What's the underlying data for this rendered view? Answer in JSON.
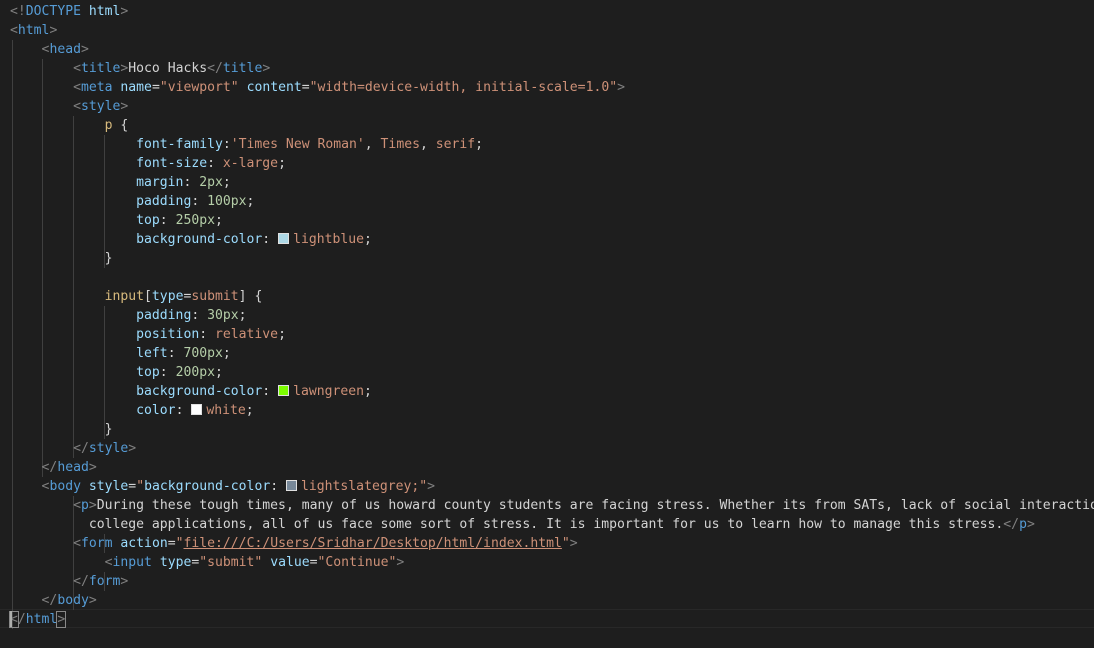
{
  "lines": [
    {
      "tokens": [
        {
          "t": "<!",
          "c": "punc"
        },
        {
          "t": "DOCTYPE",
          "c": "tag"
        },
        {
          "t": " html",
          "c": "attr"
        },
        {
          "t": ">",
          "c": "punc"
        }
      ]
    },
    {
      "tokens": [
        {
          "t": "<",
          "c": "punc"
        },
        {
          "t": "html",
          "c": "tag"
        },
        {
          "t": ">",
          "c": "punc"
        }
      ]
    },
    {
      "tokens": [
        {
          "t": "    "
        },
        {
          "t": "<",
          "c": "punc"
        },
        {
          "t": "head",
          "c": "tag"
        },
        {
          "t": ">",
          "c": "punc"
        }
      ]
    },
    {
      "tokens": [
        {
          "t": "        "
        },
        {
          "t": "<",
          "c": "punc"
        },
        {
          "t": "title",
          "c": "tag"
        },
        {
          "t": ">",
          "c": "punc"
        },
        {
          "t": "Hoco Hacks",
          "c": "text"
        },
        {
          "t": "</",
          "c": "punc"
        },
        {
          "t": "title",
          "c": "tag"
        },
        {
          "t": ">",
          "c": "punc"
        }
      ]
    },
    {
      "tokens": [
        {
          "t": "        "
        },
        {
          "t": "<",
          "c": "punc"
        },
        {
          "t": "meta",
          "c": "tag"
        },
        {
          "t": " "
        },
        {
          "t": "name",
          "c": "attr"
        },
        {
          "t": "=",
          "c": "text"
        },
        {
          "t": "\"viewport\"",
          "c": "str"
        },
        {
          "t": " "
        },
        {
          "t": "content",
          "c": "attr"
        },
        {
          "t": "=",
          "c": "text"
        },
        {
          "t": "\"width=device-width, initial-scale=1.0\"",
          "c": "str"
        },
        {
          "t": ">",
          "c": "punc"
        }
      ]
    },
    {
      "tokens": [
        {
          "t": "        "
        },
        {
          "t": "<",
          "c": "punc"
        },
        {
          "t": "style",
          "c": "tag"
        },
        {
          "t": ">",
          "c": "punc"
        }
      ]
    },
    {
      "tokens": [
        {
          "t": "            "
        },
        {
          "t": "p",
          "c": "sel"
        },
        {
          "t": " {",
          "c": "text"
        }
      ]
    },
    {
      "tokens": [
        {
          "t": "                "
        },
        {
          "t": "font-family",
          "c": "prop"
        },
        {
          "t": ":",
          "c": "text"
        },
        {
          "t": "'Times New Roman'",
          "c": "val"
        },
        {
          "t": ", ",
          "c": "text"
        },
        {
          "t": "Times",
          "c": "val"
        },
        {
          "t": ", ",
          "c": "text"
        },
        {
          "t": "serif",
          "c": "val"
        },
        {
          "t": ";",
          "c": "text"
        }
      ]
    },
    {
      "tokens": [
        {
          "t": "                "
        },
        {
          "t": "font-size",
          "c": "prop"
        },
        {
          "t": ": ",
          "c": "text"
        },
        {
          "t": "x-large",
          "c": "val"
        },
        {
          "t": ";",
          "c": "text"
        }
      ]
    },
    {
      "tokens": [
        {
          "t": "                "
        },
        {
          "t": "margin",
          "c": "prop"
        },
        {
          "t": ": ",
          "c": "text"
        },
        {
          "t": "2px",
          "c": "num"
        },
        {
          "t": ";",
          "c": "text"
        }
      ]
    },
    {
      "tokens": [
        {
          "t": "                "
        },
        {
          "t": "padding",
          "c": "prop"
        },
        {
          "t": ": ",
          "c": "text"
        },
        {
          "t": "100px",
          "c": "num"
        },
        {
          "t": ";",
          "c": "text"
        }
      ]
    },
    {
      "tokens": [
        {
          "t": "                "
        },
        {
          "t": "top",
          "c": "prop"
        },
        {
          "t": ": ",
          "c": "text"
        },
        {
          "t": "250px",
          "c": "num"
        },
        {
          "t": ";",
          "c": "text"
        }
      ]
    },
    {
      "tokens": [
        {
          "t": "                "
        },
        {
          "t": "background-color",
          "c": "prop"
        },
        {
          "t": ": ",
          "c": "text"
        },
        {
          "swatch": "#add8e6"
        },
        {
          "t": "lightblue",
          "c": "val"
        },
        {
          "t": ";",
          "c": "text"
        }
      ]
    },
    {
      "tokens": [
        {
          "t": "            "
        },
        {
          "t": "}",
          "c": "text"
        }
      ]
    },
    {
      "tokens": []
    },
    {
      "tokens": [
        {
          "t": "            "
        },
        {
          "t": "input",
          "c": "sel"
        },
        {
          "t": "[",
          "c": "text"
        },
        {
          "t": "type",
          "c": "attr"
        },
        {
          "t": "=",
          "c": "text"
        },
        {
          "t": "submit",
          "c": "val"
        },
        {
          "t": "] {",
          "c": "text"
        }
      ]
    },
    {
      "tokens": [
        {
          "t": "                "
        },
        {
          "t": "padding",
          "c": "prop"
        },
        {
          "t": ": ",
          "c": "text"
        },
        {
          "t": "30px",
          "c": "num"
        },
        {
          "t": ";",
          "c": "text"
        }
      ]
    },
    {
      "tokens": [
        {
          "t": "                "
        },
        {
          "t": "position",
          "c": "prop"
        },
        {
          "t": ": ",
          "c": "text"
        },
        {
          "t": "relative",
          "c": "val"
        },
        {
          "t": ";",
          "c": "text"
        }
      ]
    },
    {
      "tokens": [
        {
          "t": "                "
        },
        {
          "t": "left",
          "c": "prop"
        },
        {
          "t": ": ",
          "c": "text"
        },
        {
          "t": "700px",
          "c": "num"
        },
        {
          "t": ";",
          "c": "text"
        }
      ]
    },
    {
      "tokens": [
        {
          "t": "                "
        },
        {
          "t": "top",
          "c": "prop"
        },
        {
          "t": ": ",
          "c": "text"
        },
        {
          "t": "200px",
          "c": "num"
        },
        {
          "t": ";",
          "c": "text"
        }
      ]
    },
    {
      "tokens": [
        {
          "t": "                "
        },
        {
          "t": "background-color",
          "c": "prop"
        },
        {
          "t": ": ",
          "c": "text"
        },
        {
          "swatch": "#7cfc00"
        },
        {
          "t": "lawngreen",
          "c": "val"
        },
        {
          "t": ";",
          "c": "text"
        }
      ]
    },
    {
      "tokens": [
        {
          "t": "                "
        },
        {
          "t": "color",
          "c": "prop"
        },
        {
          "t": ": ",
          "c": "text"
        },
        {
          "swatch": "#ffffff"
        },
        {
          "t": "white",
          "c": "val"
        },
        {
          "t": ";",
          "c": "text"
        }
      ]
    },
    {
      "tokens": [
        {
          "t": "            "
        },
        {
          "t": "}",
          "c": "text"
        }
      ]
    },
    {
      "tokens": [
        {
          "t": "        "
        },
        {
          "t": "</",
          "c": "punc"
        },
        {
          "t": "style",
          "c": "tag"
        },
        {
          "t": ">",
          "c": "punc"
        }
      ]
    },
    {
      "tokens": [
        {
          "t": "    "
        },
        {
          "t": "</",
          "c": "punc"
        },
        {
          "t": "head",
          "c": "tag"
        },
        {
          "t": ">",
          "c": "punc"
        }
      ]
    },
    {
      "tokens": [
        {
          "t": "    "
        },
        {
          "t": "<",
          "c": "punc"
        },
        {
          "t": "body",
          "c": "tag"
        },
        {
          "t": " "
        },
        {
          "t": "style",
          "c": "attr"
        },
        {
          "t": "=",
          "c": "text"
        },
        {
          "t": "\"",
          "c": "str"
        },
        {
          "t": "background-color",
          "c": "prop"
        },
        {
          "t": ": ",
          "c": "text"
        },
        {
          "swatch": "#778899"
        },
        {
          "t": "lightslategrey",
          "c": "val"
        },
        {
          "t": ";\"",
          "c": "str"
        },
        {
          "t": ">",
          "c": "punc"
        }
      ]
    },
    {
      "tokens": [
        {
          "t": "        "
        },
        {
          "t": "<",
          "c": "punc"
        },
        {
          "t": "p",
          "c": "tag"
        },
        {
          "t": ">",
          "c": "punc"
        },
        {
          "t": "During these tough times, many of us howard county students are facing stress. Whether its from SATs, lack of social interaction, or",
          "c": "text"
        }
      ]
    },
    {
      "tokens": [
        {
          "t": "          "
        },
        {
          "t": "college applications, all of us face some sort of stress. It is important for us to learn how to manage this stress.",
          "c": "text"
        },
        {
          "t": "</",
          "c": "punc"
        },
        {
          "t": "p",
          "c": "tag"
        },
        {
          "t": ">",
          "c": "punc"
        }
      ]
    },
    {
      "tokens": [
        {
          "t": "        "
        },
        {
          "t": "<",
          "c": "punc"
        },
        {
          "t": "form",
          "c": "tag"
        },
        {
          "t": " "
        },
        {
          "t": "action",
          "c": "attr"
        },
        {
          "t": "=",
          "c": "text"
        },
        {
          "t": "\"",
          "c": "str"
        },
        {
          "t": "file:///C:/Users/Sridhar/Desktop/html/index.html",
          "c": "str",
          "link": true
        },
        {
          "t": "\"",
          "c": "str"
        },
        {
          "t": ">",
          "c": "punc"
        }
      ]
    },
    {
      "tokens": [
        {
          "t": "            "
        },
        {
          "t": "<",
          "c": "punc"
        },
        {
          "t": "input",
          "c": "tag"
        },
        {
          "t": " "
        },
        {
          "t": "type",
          "c": "attr"
        },
        {
          "t": "=",
          "c": "text"
        },
        {
          "t": "\"submit\"",
          "c": "str"
        },
        {
          "t": " "
        },
        {
          "t": "value",
          "c": "attr"
        },
        {
          "t": "=",
          "c": "text"
        },
        {
          "t": "\"Continue\"",
          "c": "str"
        },
        {
          "t": ">",
          "c": "punc"
        }
      ]
    },
    {
      "tokens": [
        {
          "t": "        "
        },
        {
          "t": "</",
          "c": "punc"
        },
        {
          "t": "form",
          "c": "tag"
        },
        {
          "t": ">",
          "c": "punc"
        }
      ]
    },
    {
      "tokens": [
        {
          "t": "    "
        },
        {
          "t": "</",
          "c": "punc"
        },
        {
          "t": "body",
          "c": "tag"
        },
        {
          "t": ">",
          "c": "punc"
        }
      ]
    },
    {
      "tokens": [
        {
          "t": "<",
          "c": "punc",
          "bm": true
        },
        {
          "t": "/",
          "c": "punc"
        },
        {
          "t": "html",
          "c": "tag"
        },
        {
          "t": ">",
          "c": "punc",
          "bm": true
        }
      ]
    }
  ]
}
